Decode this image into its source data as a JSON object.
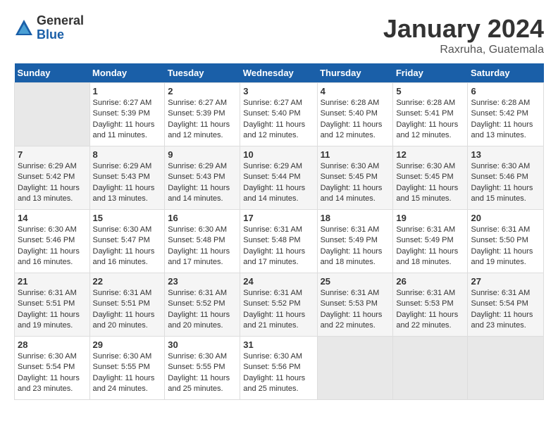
{
  "logo": {
    "general": "General",
    "blue": "Blue"
  },
  "title": "January 2024",
  "subtitle": "Raxruha, Guatemala",
  "headers": [
    "Sunday",
    "Monday",
    "Tuesday",
    "Wednesday",
    "Thursday",
    "Friday",
    "Saturday"
  ],
  "weeks": [
    [
      {
        "day": "",
        "info": ""
      },
      {
        "day": "1",
        "info": "Sunrise: 6:27 AM\nSunset: 5:39 PM\nDaylight: 11 hours\nand 11 minutes."
      },
      {
        "day": "2",
        "info": "Sunrise: 6:27 AM\nSunset: 5:39 PM\nDaylight: 11 hours\nand 12 minutes."
      },
      {
        "day": "3",
        "info": "Sunrise: 6:27 AM\nSunset: 5:40 PM\nDaylight: 11 hours\nand 12 minutes."
      },
      {
        "day": "4",
        "info": "Sunrise: 6:28 AM\nSunset: 5:40 PM\nDaylight: 11 hours\nand 12 minutes."
      },
      {
        "day": "5",
        "info": "Sunrise: 6:28 AM\nSunset: 5:41 PM\nDaylight: 11 hours\nand 12 minutes."
      },
      {
        "day": "6",
        "info": "Sunrise: 6:28 AM\nSunset: 5:42 PM\nDaylight: 11 hours\nand 13 minutes."
      }
    ],
    [
      {
        "day": "7",
        "info": "Sunrise: 6:29 AM\nSunset: 5:42 PM\nDaylight: 11 hours\nand 13 minutes."
      },
      {
        "day": "8",
        "info": "Sunrise: 6:29 AM\nSunset: 5:43 PM\nDaylight: 11 hours\nand 13 minutes."
      },
      {
        "day": "9",
        "info": "Sunrise: 6:29 AM\nSunset: 5:43 PM\nDaylight: 11 hours\nand 14 minutes."
      },
      {
        "day": "10",
        "info": "Sunrise: 6:29 AM\nSunset: 5:44 PM\nDaylight: 11 hours\nand 14 minutes."
      },
      {
        "day": "11",
        "info": "Sunrise: 6:30 AM\nSunset: 5:45 PM\nDaylight: 11 hours\nand 14 minutes."
      },
      {
        "day": "12",
        "info": "Sunrise: 6:30 AM\nSunset: 5:45 PM\nDaylight: 11 hours\nand 15 minutes."
      },
      {
        "day": "13",
        "info": "Sunrise: 6:30 AM\nSunset: 5:46 PM\nDaylight: 11 hours\nand 15 minutes."
      }
    ],
    [
      {
        "day": "14",
        "info": "Sunrise: 6:30 AM\nSunset: 5:46 PM\nDaylight: 11 hours\nand 16 minutes."
      },
      {
        "day": "15",
        "info": "Sunrise: 6:30 AM\nSunset: 5:47 PM\nDaylight: 11 hours\nand 16 minutes."
      },
      {
        "day": "16",
        "info": "Sunrise: 6:30 AM\nSunset: 5:48 PM\nDaylight: 11 hours\nand 17 minutes."
      },
      {
        "day": "17",
        "info": "Sunrise: 6:31 AM\nSunset: 5:48 PM\nDaylight: 11 hours\nand 17 minutes."
      },
      {
        "day": "18",
        "info": "Sunrise: 6:31 AM\nSunset: 5:49 PM\nDaylight: 11 hours\nand 18 minutes."
      },
      {
        "day": "19",
        "info": "Sunrise: 6:31 AM\nSunset: 5:49 PM\nDaylight: 11 hours\nand 18 minutes."
      },
      {
        "day": "20",
        "info": "Sunrise: 6:31 AM\nSunset: 5:50 PM\nDaylight: 11 hours\nand 19 minutes."
      }
    ],
    [
      {
        "day": "21",
        "info": "Sunrise: 6:31 AM\nSunset: 5:51 PM\nDaylight: 11 hours\nand 19 minutes."
      },
      {
        "day": "22",
        "info": "Sunrise: 6:31 AM\nSunset: 5:51 PM\nDaylight: 11 hours\nand 20 minutes."
      },
      {
        "day": "23",
        "info": "Sunrise: 6:31 AM\nSunset: 5:52 PM\nDaylight: 11 hours\nand 20 minutes."
      },
      {
        "day": "24",
        "info": "Sunrise: 6:31 AM\nSunset: 5:52 PM\nDaylight: 11 hours\nand 21 minutes."
      },
      {
        "day": "25",
        "info": "Sunrise: 6:31 AM\nSunset: 5:53 PM\nDaylight: 11 hours\nand 22 minutes."
      },
      {
        "day": "26",
        "info": "Sunrise: 6:31 AM\nSunset: 5:53 PM\nDaylight: 11 hours\nand 22 minutes."
      },
      {
        "day": "27",
        "info": "Sunrise: 6:31 AM\nSunset: 5:54 PM\nDaylight: 11 hours\nand 23 minutes."
      }
    ],
    [
      {
        "day": "28",
        "info": "Sunrise: 6:30 AM\nSunset: 5:54 PM\nDaylight: 11 hours\nand 23 minutes."
      },
      {
        "day": "29",
        "info": "Sunrise: 6:30 AM\nSunset: 5:55 PM\nDaylight: 11 hours\nand 24 minutes."
      },
      {
        "day": "30",
        "info": "Sunrise: 6:30 AM\nSunset: 5:55 PM\nDaylight: 11 hours\nand 25 minutes."
      },
      {
        "day": "31",
        "info": "Sunrise: 6:30 AM\nSunset: 5:56 PM\nDaylight: 11 hours\nand 25 minutes."
      },
      {
        "day": "",
        "info": ""
      },
      {
        "day": "",
        "info": ""
      },
      {
        "day": "",
        "info": ""
      }
    ]
  ]
}
